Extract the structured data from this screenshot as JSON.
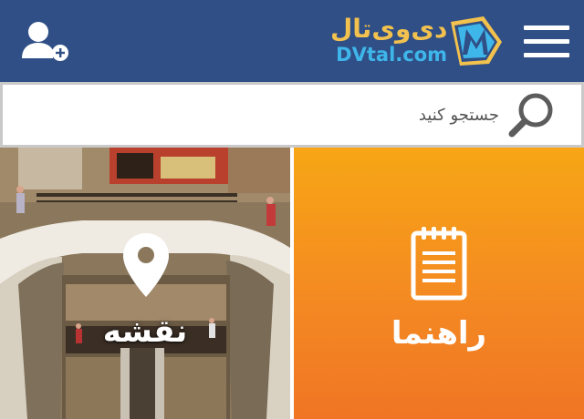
{
  "header": {
    "logo_fa": "دی‌وی‌تال",
    "logo_en": "DVtal.com",
    "icons": {
      "user_add": "user-add-icon",
      "menu": "hamburger-menu-icon",
      "logo_mark": "dvtal-logo-icon"
    },
    "bg_color": "#2f4f86"
  },
  "search": {
    "placeholder": "جستجو کنید",
    "icon": "search-icon"
  },
  "tiles": {
    "map": {
      "label": "نقشه",
      "icon": "map-pin-icon"
    },
    "guide": {
      "label": "راهنما",
      "icon": "notepad-icon"
    }
  },
  "colors": {
    "accent_orange": "#f48a22",
    "logo_gold": "#f2c14e",
    "logo_blue": "#3fb6ea"
  }
}
